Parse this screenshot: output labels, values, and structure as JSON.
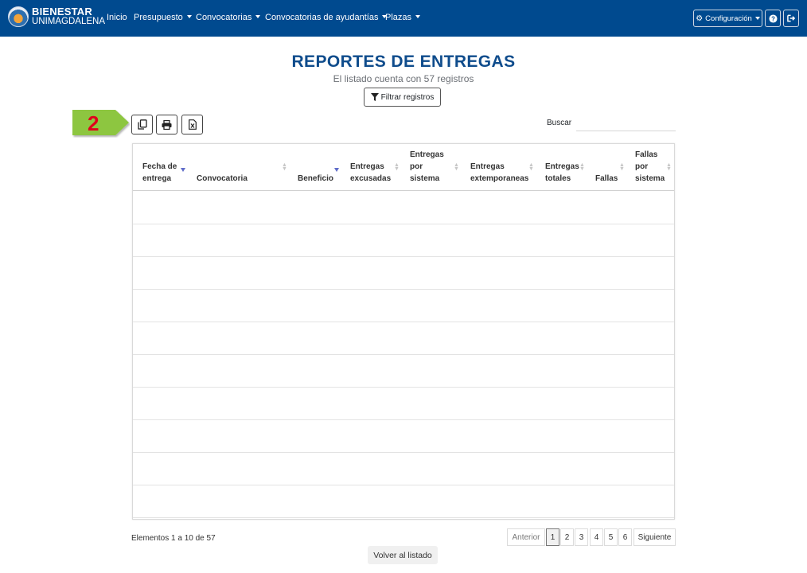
{
  "brand": {
    "title": "BIENESTAR",
    "subtitle": "UNIMAGDALENA",
    "logo_icon": "university-seal-icon"
  },
  "nav": {
    "items": [
      {
        "label": "Inicio",
        "has_caret": false
      },
      {
        "label": "Presupuesto",
        "has_caret": true
      },
      {
        "label": "Convocatorias",
        "has_caret": true
      },
      {
        "label": "Convocatorias de ayudantías",
        "has_caret": true
      },
      {
        "label": "Plazas",
        "has_caret": true
      }
    ],
    "config_label": "Configuración",
    "config_icon": "gear-icon",
    "help_icon": "question-circle-icon",
    "logout_icon": "sign-out-icon",
    "background_color": "#004a8f"
  },
  "header": {
    "title": "REPORTES DE ENTREGAS",
    "subtitle": "El listado cuenta con 57 registros",
    "filter_label": "Filtrar registros",
    "filter_icon": "filter-icon",
    "title_color": "#0f4c8c"
  },
  "annotation": {
    "step": "2",
    "arrow_color": "#8dc63f",
    "number_color": "#e0001b"
  },
  "toolbar": {
    "buttons": [
      {
        "name": "copy",
        "icon": "copy-icon"
      },
      {
        "name": "print",
        "icon": "print-icon"
      },
      {
        "name": "excel",
        "icon": "excel-file-icon"
      }
    ],
    "search_label": "Buscar",
    "search_value": "",
    "search_placeholder": ""
  },
  "table": {
    "columns": [
      {
        "label": "Fecha de entrega",
        "sort": "desc"
      },
      {
        "label": "Convocatoria",
        "sort": "both"
      },
      {
        "label": "Beneficio",
        "sort": "desc"
      },
      {
        "label": "Entregas excusadas",
        "sort": "both"
      },
      {
        "label": "Entregas por sistema",
        "sort": "both"
      },
      {
        "label": "Entregas extemporaneas",
        "sort": "both"
      },
      {
        "label": "Entregas totales",
        "sort": "both"
      },
      {
        "label": "Fallas",
        "sort": "both"
      },
      {
        "label": "Fallas por sistema",
        "sort": "both"
      }
    ],
    "rows": [
      [],
      [],
      [],
      [],
      [],
      [],
      [],
      [],
      [],
      []
    ]
  },
  "footer": {
    "info": "Elementos 1 a 10 de 57",
    "prev_label": "Anterior",
    "pages": [
      "1",
      "2",
      "3",
      "4",
      "5",
      "6"
    ],
    "current_page": "1",
    "next_label": "Siguiente",
    "back_label": "Volver al listado"
  }
}
